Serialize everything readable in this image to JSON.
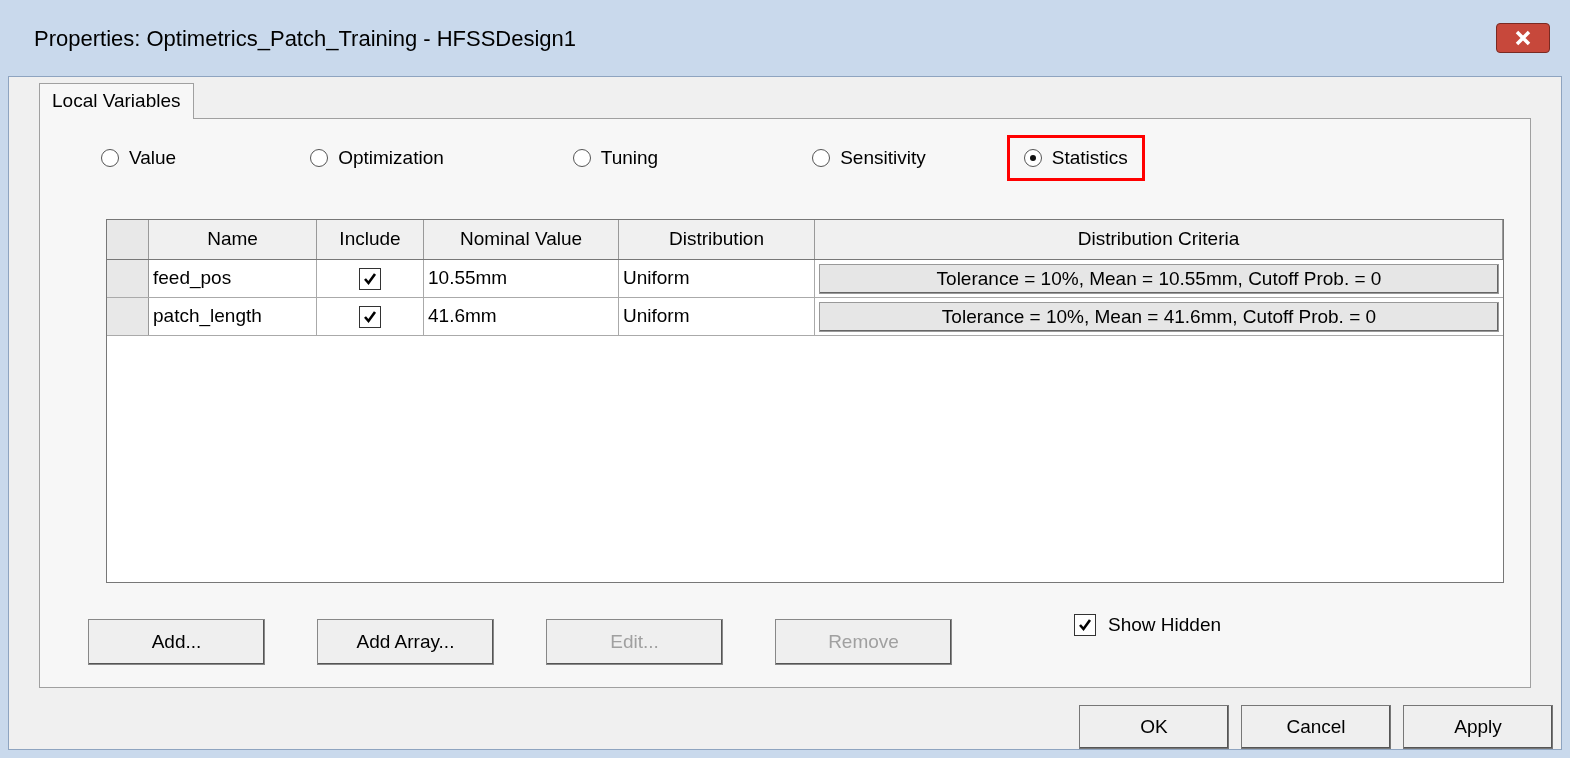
{
  "window": {
    "title": "Properties: Optimetrics_Patch_Training - HFSSDesign1"
  },
  "tabs": [
    {
      "label": "Local Variables",
      "selected": true
    }
  ],
  "modes": [
    {
      "label": "Value",
      "selected": false,
      "highlighted": false
    },
    {
      "label": "Optimization",
      "selected": false,
      "highlighted": false
    },
    {
      "label": "Tuning",
      "selected": false,
      "highlighted": false
    },
    {
      "label": "Sensitivity",
      "selected": false,
      "highlighted": false
    },
    {
      "label": "Statistics",
      "selected": true,
      "highlighted": true
    }
  ],
  "table": {
    "columns": [
      "Name",
      "Include",
      "Nominal Value",
      "Distribution",
      "Distribution Criteria"
    ],
    "rows": [
      {
        "name": "feed_pos",
        "include": true,
        "nominal": "10.55mm",
        "distribution": "Uniform",
        "criteria": "Tolerance = 10%, Mean = 10.55mm, Cutoff Prob. = 0"
      },
      {
        "name": "patch_length",
        "include": true,
        "nominal": "41.6mm",
        "distribution": "Uniform",
        "criteria": "Tolerance = 10%, Mean = 41.6mm, Cutoff Prob. = 0"
      }
    ]
  },
  "actions": [
    {
      "label": "Add...",
      "disabled": false
    },
    {
      "label": "Add Array...",
      "disabled": false
    },
    {
      "label": "Edit...",
      "disabled": true
    },
    {
      "label": "Remove",
      "disabled": true
    }
  ],
  "show_hidden": {
    "label": "Show Hidden",
    "checked": true
  },
  "dialog_buttons": [
    "OK",
    "Cancel",
    "Apply"
  ]
}
